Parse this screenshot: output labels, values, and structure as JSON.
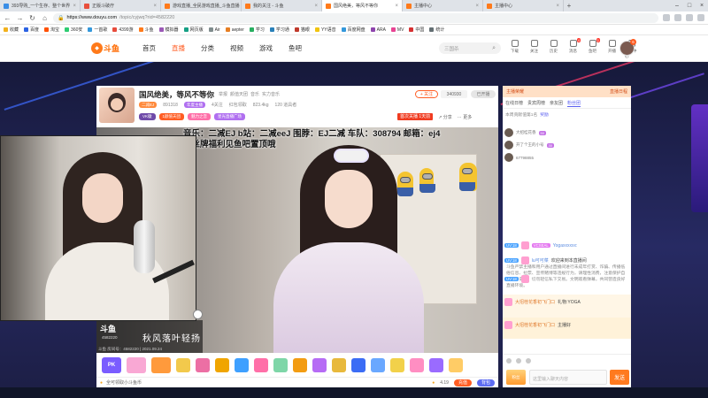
{
  "browser": {
    "tabs": [
      {
        "label": "393导购_一个生存、整个世界",
        "color": "#3a8ee6",
        "active": false
      },
      {
        "label": "正版斗破疗",
        "color": "#e84f3c",
        "active": false
      },
      {
        "label": "游戏直播_全民游戏直播_斗鱼直播",
        "color": "#ff7a1a",
        "active": false
      },
      {
        "label": "我的关注 - 斗鱼",
        "color": "#ff7a1a",
        "active": false
      },
      {
        "label": "国风绝美，等风不等你",
        "color": "#ff7a1a",
        "active": true
      },
      {
        "label": "主播中心",
        "color": "#ff7a1a",
        "active": false
      },
      {
        "label": "主播中心",
        "color": "#ff7a1a",
        "active": false
      }
    ],
    "url_host": "https://www.douyu.com",
    "url_path": "/topic/cyjwq?rid=4582220",
    "bookmarks": [
      {
        "label": "收藏",
        "color": "#f2b11d"
      },
      {
        "label": "百度",
        "color": "#2c63e3"
      },
      {
        "label": "淘宝",
        "color": "#ff5000"
      },
      {
        "label": "360安",
        "color": "#2ecc71"
      },
      {
        "label": "一首歌",
        "color": "#3498db"
      },
      {
        "label": "4399游",
        "color": "#e74c3c"
      },
      {
        "label": "斗鱼",
        "color": "#ff7a1a"
      },
      {
        "label": "模拟器",
        "color": "#9b59b6"
      },
      {
        "label": "网页版",
        "color": "#16a085"
      },
      {
        "label": "Air",
        "color": "#7f8c8d"
      },
      {
        "label": "aepter",
        "color": "#e67e22"
      },
      {
        "label": "学习",
        "color": "#27ae60"
      },
      {
        "label": "学习通",
        "color": "#2980b9"
      },
      {
        "label": "猫眼",
        "color": "#c0392b"
      },
      {
        "label": "YY语音",
        "color": "#f1c40f"
      },
      {
        "label": "百度网盘",
        "color": "#3498db"
      },
      {
        "label": "ARA",
        "color": "#8e44ad"
      },
      {
        "label": "MV",
        "color": "#e84393"
      },
      {
        "label": "中国",
        "color": "#d63031"
      },
      {
        "label": "统计",
        "color": "#636e72"
      }
    ]
  },
  "site": {
    "logo_text": "斗鱼",
    "nav": [
      {
        "label": "首页",
        "active": false
      },
      {
        "label": "直播",
        "active": true
      },
      {
        "label": "分类",
        "active": false
      },
      {
        "label": "视频",
        "active": false
      },
      {
        "label": "游戏",
        "active": false
      },
      {
        "label": "鱼吧",
        "active": false
      }
    ],
    "search_placeholder": "三国杀",
    "header_icons": [
      {
        "label": "下载",
        "badge": ""
      },
      {
        "label": "关注",
        "badge": ""
      },
      {
        "label": "历史",
        "badge": ""
      },
      {
        "label": "消息",
        "badge": "4"
      },
      {
        "label": "鱼吧",
        "badge": "1"
      },
      {
        "label": "开播",
        "badge": ""
      },
      {
        "label": "创作中心",
        "badge": ""
      }
    ],
    "avatar_badge": "6"
  },
  "room": {
    "title": "国风绝美，等风不等你",
    "category": [
      "举报",
      "颜值天团",
      "音乐",
      "实力音乐"
    ],
    "level_tag": "二减EJ",
    "fans_num": "891318",
    "meta": [
      "年度主播",
      "4关注",
      "红包领取",
      "823.4kg",
      "120 道具者"
    ],
    "tags": [
      {
        "label": "VK徽",
        "color": "#6f4aa9"
      },
      {
        "label": "1颜值天团",
        "color": "#ff5d23"
      },
      {
        "label": "魅力之音",
        "color": "#ff6fa8"
      },
      {
        "label": "星光直播广场",
        "color": "#b06ff0"
      }
    ],
    "follow_label": "+ 关注",
    "follow_count": "340930",
    "live_badge": "已开播",
    "rank_label": "首次关播",
    "rank_value": "1天前",
    "share_label": "分享",
    "more_label": "更多"
  },
  "stream": {
    "ticker_line1": "音乐：二减EJ  b站：二减eeJ  围脖：EJ二减  车队：308794  邮箱：ej4",
    "ticker_line2": "粉丝牌福利见鱼吧置顶哦",
    "watermark_logo": "斗鱼",
    "watermark_room": "4582220",
    "watermark_slogan": "秋风落叶轻扬",
    "watermark_footer": "斗鱼 房间号：4582220 | 2021.09.24"
  },
  "gifts": [
    {
      "color": "#7a5cff",
      "label": "PK"
    },
    {
      "color": "#f9a8d4",
      "label": ""
    },
    {
      "color": "#ff9a3c",
      "label": ""
    },
    {
      "color": "#f2c94c",
      "label": ""
    },
    {
      "color": "#ec6fa4",
      "label": ""
    },
    {
      "color": "#f0a500",
      "label": ""
    },
    {
      "color": "#3ea0ff",
      "label": ""
    },
    {
      "color": "#ff6fa8",
      "label": ""
    },
    {
      "color": "#7ed6a8",
      "label": ""
    },
    {
      "color": "#f39c12",
      "label": ""
    },
    {
      "color": "#b66bf5",
      "label": ""
    },
    {
      "color": "#e8b93c",
      "label": ""
    },
    {
      "color": "#3b6cf5",
      "label": ""
    },
    {
      "color": "#6aa8ff",
      "label": ""
    },
    {
      "color": "#f2d14a",
      "label": ""
    },
    {
      "color": "#ff8ec2",
      "label": ""
    },
    {
      "color": "#9a6bff",
      "label": ""
    },
    {
      "color": "#ffcc66",
      "label": ""
    }
  ],
  "bottombar": {
    "left_text": "全可领取小斗鱼币",
    "balance": "4.19",
    "charge_label": "充值",
    "backpack_label": "背包"
  },
  "chat": {
    "header": [
      "主播荣耀",
      "直播日程"
    ],
    "tabs": [
      {
        "label": "在线日榜",
        "active": false
      },
      {
        "label": "贵宾周榜",
        "active": false
      },
      {
        "label": "亲友团",
        "active": false
      },
      {
        "label": "粉丝团",
        "active": true
      }
    ],
    "rank_text": "本周贡献值第1名",
    "rank_user": "奖励",
    "vips": [
      {
        "name": "大招桂花香",
        "level": "50"
      },
      {
        "name": "开了个王的小号",
        "level": "30"
      },
      {
        "name": "67798855",
        "level": ""
      }
    ],
    "notice": "斗鱼严禁主播和用户通过直播间进行未成年打赏、诈骗、传播低俗信息、拉票、宣传赌博等违规行为，请理性消费，注意保护自身财产安全，切勿轻信私下交易。文明观看弹幕，共同营造良好直播环境。",
    "messages": [
      {
        "lv": "UV:18",
        "medal": "VCSEAL",
        "name": "Yogaxxxxxx:",
        "text": "",
        "orange": false
      },
      {
        "lv": "UV:18",
        "medal": "",
        "name": "lu可可菜",
        "text": "欢迎来到本直播间",
        "orange": false
      },
      {
        "lv": "UV:18",
        "medal": "",
        "name": "",
        "text": "",
        "orange": false
      },
      {
        "lv": "",
        "medal": "",
        "name": "大招桂花香初飞门口",
        "text": "礼物:YOGA",
        "orange": true
      },
      {
        "lv": "",
        "medal": "",
        "name": "大招桂花香初飞门口",
        "text": "主播好",
        "orange": true
      }
    ],
    "input_placeholder": "这里输入聊天内容",
    "send_label": "发送",
    "fans_badge": "粉丝"
  }
}
